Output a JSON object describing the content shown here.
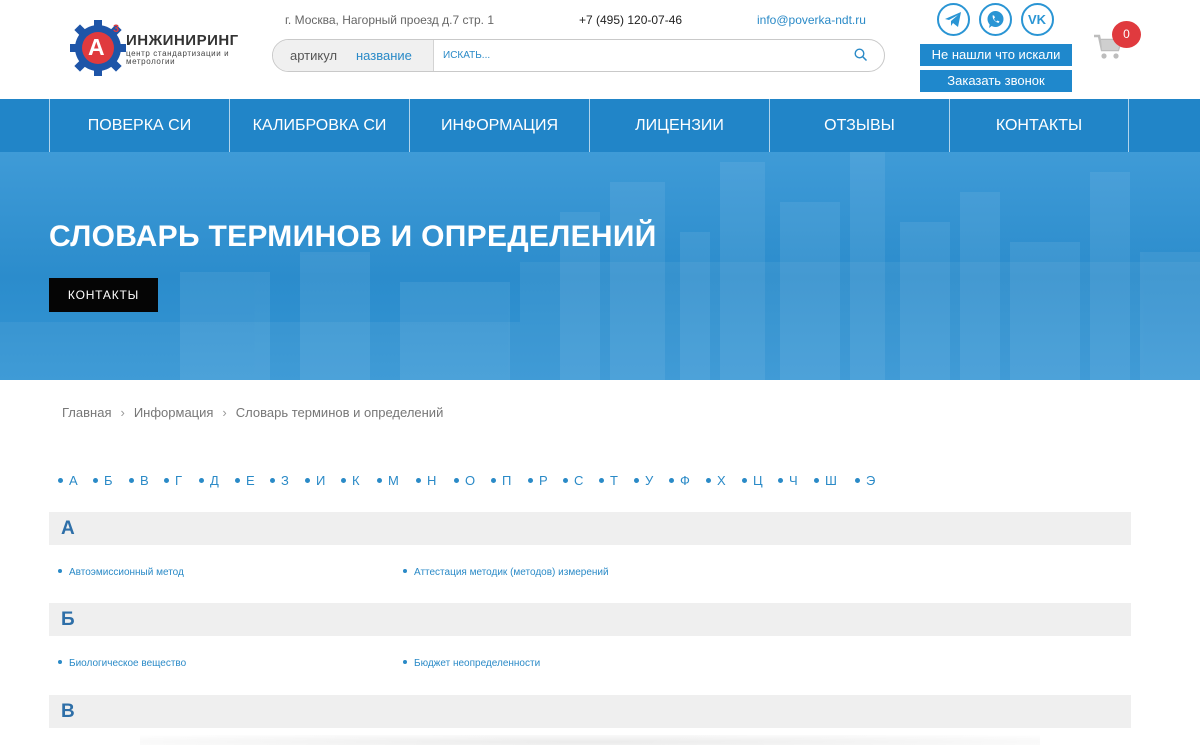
{
  "header": {
    "logo_name": "ИНЖИНИРИНГ",
    "logo_sub": "центр стандартизации и метрологии",
    "logo_badge": "А",
    "logo_badge_sup": "3",
    "address": "г. Москва, Нагорный проезд д.7 стр. 1",
    "phone": "+7 (495) 120-07-46",
    "email": "info@poverka-ndt.ru",
    "social_icons": [
      "telegram-icon",
      "whatsapp-icon",
      "vk-icon"
    ],
    "not_found_label": "Не нашли что искали",
    "callback_label": "Заказать звонок",
    "cart_count": "0"
  },
  "search": {
    "tab_article": "артикул",
    "tab_name": "название",
    "placeholder": "ИСКАТЬ..."
  },
  "nav": {
    "items": [
      "ПОВЕРКА СИ",
      "КАЛИБРОВКА СИ",
      "ИНФОРМАЦИЯ",
      "ЛИЦЕНЗИИ",
      "ОТЗЫВЫ",
      "КОНТАКТЫ"
    ]
  },
  "hero": {
    "title": "СЛОВАРЬ ТЕРМИНОВ И ОПРЕДЕЛЕНИЙ",
    "button": "КОНТАКТЫ"
  },
  "breadcrumb": [
    "Главная",
    "Информация",
    "Словарь терминов и определений"
  ],
  "letters": [
    "А",
    "Б",
    "В",
    "Г",
    "Д",
    "Е",
    "З",
    "И",
    "К",
    "М",
    "Н",
    "О",
    "П",
    "Р",
    "С",
    "Т",
    "У",
    "Ф",
    "Х",
    "Ц",
    "Ч",
    "Ш",
    "Э"
  ],
  "sections": [
    {
      "letter": "А",
      "terms": [
        "Автоэмиссионный метод",
        "Аттестация методик (методов) измерений"
      ]
    },
    {
      "letter": "Б",
      "terms": [
        "Биологическое вещество",
        "Бюджет неопределенности"
      ]
    },
    {
      "letter": "В",
      "terms": []
    }
  ],
  "colors": {
    "accent": "#2185c8",
    "link": "#2a8ac7",
    "badge": "#e03a3e",
    "section_bg": "#efefef"
  }
}
